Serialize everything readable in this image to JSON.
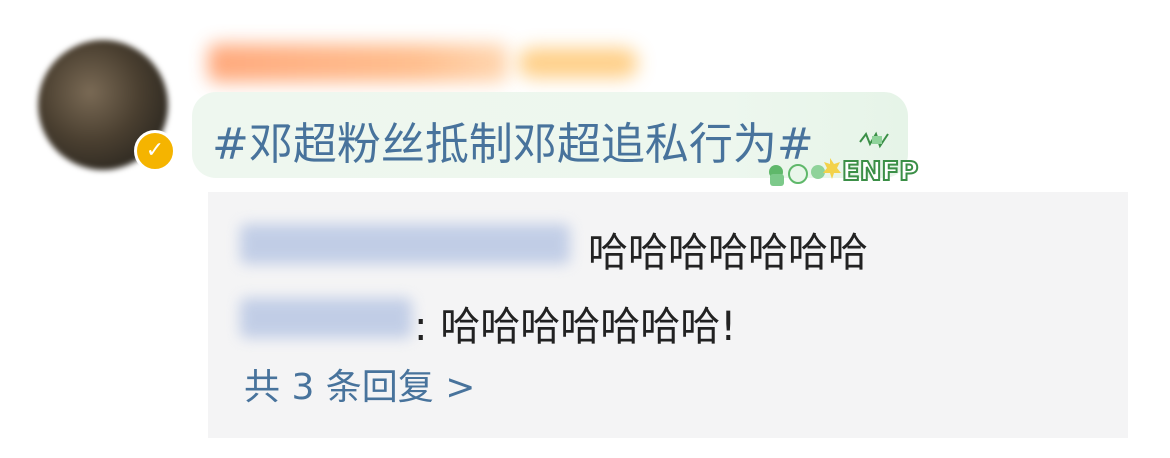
{
  "post": {
    "topic": "#邓超粉丝抵制邓超追私行为#",
    "badge": "ENFP"
  },
  "replies": {
    "items": [
      {
        "text": "哈哈哈哈哈哈哈"
      },
      {
        "text": ": 哈哈哈哈哈哈哈!"
      }
    ],
    "more_label": "共 3 条回复 >"
  },
  "colors": {
    "link": "#48739c",
    "verified": "#f5b400",
    "reply_bg": "#f4f4f5"
  },
  "icons": {
    "verified": "verified-badge-icon",
    "pendant": "enfp-pendant-icon"
  }
}
